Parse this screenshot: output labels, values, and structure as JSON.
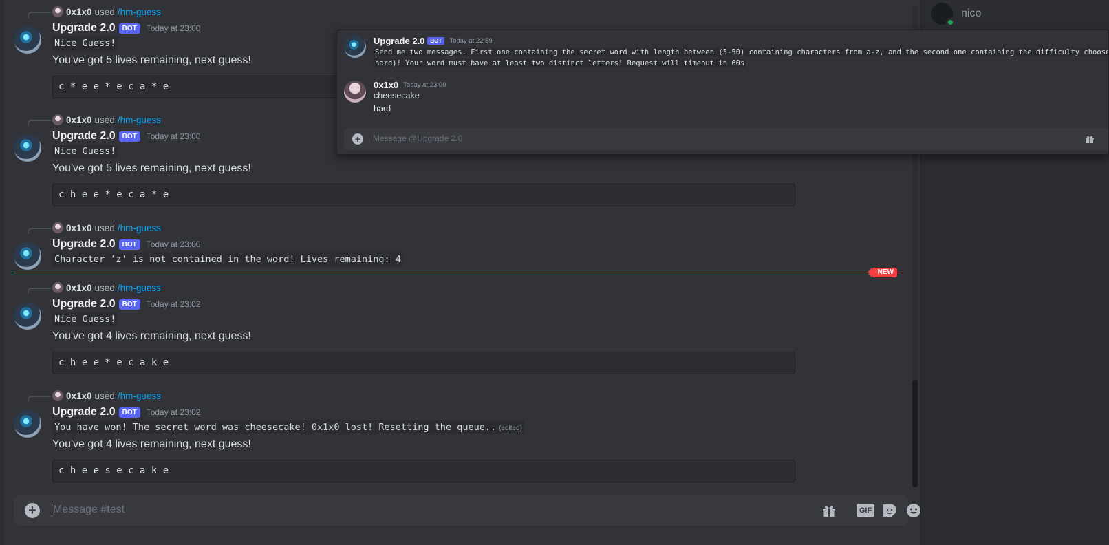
{
  "messages": [
    {
      "reply": {
        "user": "0x1x0",
        "used": "used",
        "command": "/hm-guess"
      },
      "author": "Upgrade 2.0",
      "badge": "BOT",
      "time": "Today at 23:00",
      "code_line": "Nice Guess!",
      "text": "You've got 5 lives remaining, next guess!",
      "block": "c * e e * e c a * e"
    },
    {
      "reply": {
        "user": "0x1x0",
        "used": "used",
        "command": "/hm-guess"
      },
      "author": "Upgrade 2.0",
      "badge": "BOT",
      "time": "Today at 23:00",
      "code_line": "Nice Guess!",
      "text": "You've got 5 lives remaining, next guess!",
      "block": "c h e e * e c a * e"
    },
    {
      "reply": {
        "user": "0x1x0",
        "used": "used",
        "command": "/hm-guess"
      },
      "author": "Upgrade 2.0",
      "badge": "BOT",
      "time": "Today at 23:00",
      "code_line": "Character 'z' is not contained in the word! Lives remaining: 4"
    },
    {
      "reply": {
        "user": "0x1x0",
        "used": "used",
        "command": "/hm-guess"
      },
      "author": "Upgrade 2.0",
      "badge": "BOT",
      "time": "Today at 23:02",
      "code_line": "Nice Guess!",
      "text": "You've got 4 lives remaining, next guess!",
      "block": "c h e e * e c a k e"
    },
    {
      "reply": {
        "user": "0x1x0",
        "used": "used",
        "command": "/hm-guess"
      },
      "author": "Upgrade 2.0",
      "badge": "BOT",
      "time": "Today at 23:02",
      "code_line": "You have won! The secret word was cheesecake! 0x1x0 lost! Resetting the queue..",
      "edited": "(edited)",
      "text": "You've got 4 lives remaining, next guess!",
      "block": "c h e e s e c a k e"
    }
  ],
  "new_divider": "NEW",
  "composer": {
    "placeholder": "Message #test",
    "gif_label": "GIF"
  },
  "members": [
    {
      "name": "nico",
      "status": "online"
    }
  ],
  "popout": {
    "bot_message": {
      "author": "Upgrade 2.0",
      "badge": "BOT",
      "time": "Today at 22:59",
      "line1": "Send me two messages. First one containing the secret word with length between (5-50) containing characters from a-z, and the second one containing the difficulty choose between (easy, me",
      "line2": "hard)! Your word must have at least two distinct letters! Request will timeout in 60s"
    },
    "user_message": {
      "author": "0x1x0",
      "time": "Today at 23:00",
      "lines": [
        "cheesecake",
        "hard"
      ]
    },
    "composer_placeholder": "Message @Upgrade 2.0"
  },
  "colors": {
    "accent": "#5865f2",
    "link": "#00a8fc",
    "new_divider": "#f23f43",
    "online": "#23a55a"
  }
}
